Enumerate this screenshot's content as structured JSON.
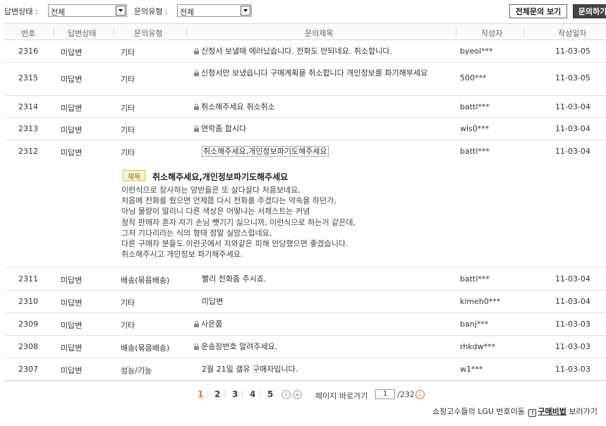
{
  "filters": {
    "status_label": "답변상태 :",
    "status_value": "전체",
    "type_label": "문의유형 :",
    "type_value": "전체"
  },
  "buttons": {
    "view_all": "전체문의 보기",
    "ask": "문의하기"
  },
  "columns": {
    "no": "번호",
    "status": "답변상태",
    "type": "문의유형",
    "title": "문의제목",
    "author": "작성자",
    "date": "작성일자"
  },
  "rows_top": [
    {
      "no": "2316",
      "status": "미답변",
      "type": "기타",
      "title": "신청서 보낼때 에러났습니다. 전화도 안되네요. 취소합니다.",
      "author": "byeol***",
      "date": "11-03-05",
      "lock": true
    },
    {
      "no": "2315",
      "status": "미답변",
      "type": "기타",
      "title": "신청서만 보냈습니다 구매계획을 취소합니다 개인정보를 파기해부세요",
      "author": "500***",
      "date": "11-03-05",
      "lock": true
    },
    {
      "no": "2314",
      "status": "미답변",
      "type": "기타",
      "title": "취소해주세요 취소취소",
      "author": "battl***",
      "date": "11-03-04",
      "lock": true
    },
    {
      "no": "2313",
      "status": "미답변",
      "type": "기타",
      "title": "연락좀 합시다",
      "author": "wls0***",
      "date": "11-03-04",
      "lock": true
    },
    {
      "no": "2312",
      "status": "미답변",
      "type": "기타",
      "title": "취소해주세요,개인정보파기도해주세요",
      "author": "battl***",
      "date": "11-03-04",
      "lock": false
    }
  ],
  "detail": {
    "badge": "제목",
    "title": "취소해주세요,개인정보파기도해주세요",
    "lines": [
      "이런식으로 장사하는 양반들은 또 살다살다 처음보네요,",
      "처음에 전화를 줬으면 언제쯤 다시 전화를 주겠다는 약속을 하던가,",
      "아님 물량이 딸리니 다른 색상은 어떻냐는 서제스트는 커녕",
      "정작 판매자 혼자 자기 손님 뺏기기 싫으니까, 이런식으로 하는거 같은데,",
      "그저 기다리라는 식의 형태 정말 실망스럽네요,",
      "다른 구매자 분들도 이런곳에서 저와같은 피해 안당했으면 좋겠습니다.",
      "취소해주시고 개인정보 파기해주세요."
    ]
  },
  "rows_bottom": [
    {
      "no": "2311",
      "status": "미답변",
      "type": "배송(묶음배송)",
      "title": "빨리 전화좀 주시죠.",
      "author": "battl***",
      "date": "11-03-04",
      "lock": false
    },
    {
      "no": "2310",
      "status": "미답변",
      "type": "기타",
      "title": "미답변",
      "author": "kimeh0***",
      "date": "11-03-04",
      "lock": false
    },
    {
      "no": "2309",
      "status": "미답변",
      "type": "기타",
      "title": "사은품",
      "author": "banj***",
      "date": "11-03-03",
      "lock": true
    },
    {
      "no": "2308",
      "status": "미답변",
      "type": "배송(묶음배송)",
      "title": "운송장번호 알려주세요.",
      "author": "rhkdw***",
      "date": "11-03-03",
      "lock": true
    },
    {
      "no": "2307",
      "status": "미답변",
      "type": "성능/기능",
      "title": "2월 21일 갤유 구매자입니다.",
      "author": "w1***",
      "date": "11-03-03",
      "lock": false
    }
  ],
  "pagination": {
    "pages": [
      "1",
      "2",
      "3",
      "4",
      "5"
    ],
    "current": "1",
    "goto_label": "페이지 바로가기",
    "goto_value": "1",
    "total": "/232"
  },
  "footer": {
    "text_before": "쇼핑고수들의 LGU 번호이동",
    "link": "구매비법",
    "text_after": "보러가기"
  },
  "colors": {
    "accent": "#f26522",
    "dark_button": "#444444"
  }
}
